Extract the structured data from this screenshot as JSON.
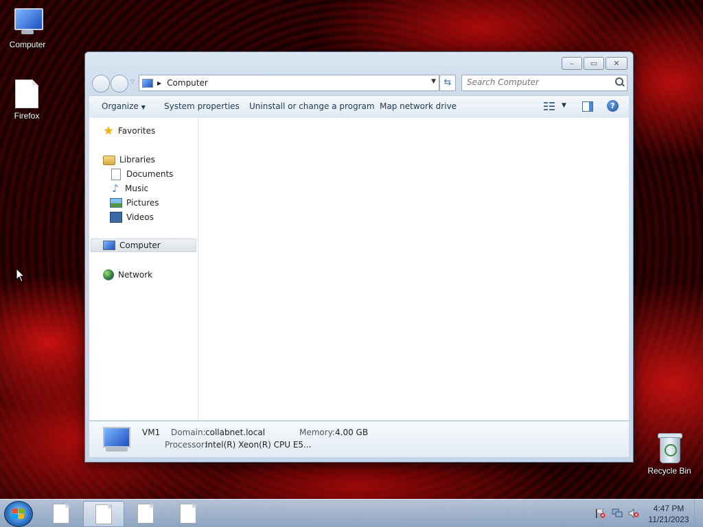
{
  "desktop": {
    "icons": [
      {
        "label": "Computer"
      },
      {
        "label": "Firefox"
      },
      {
        "label": "Recycle Bin"
      }
    ]
  },
  "window": {
    "caption_buttons": {
      "minimize": "–",
      "maximize": "▭",
      "close": "✕"
    },
    "address": {
      "current": "Computer"
    },
    "search": {
      "placeholder": "Search Computer"
    },
    "commands": {
      "organize": "Organize",
      "system_properties": "System properties",
      "uninstall": "Uninstall or change a program",
      "map_drive": "Map network drive"
    },
    "help_glyph": "?",
    "nav_pane": {
      "favorites": "Favorites",
      "libraries": "Libraries",
      "documents": "Documents",
      "music": "Music",
      "pictures": "Pictures",
      "videos": "Videos",
      "computer": "Computer",
      "network": "Network"
    },
    "details": {
      "name": "VM1",
      "domain_label": "Domain:",
      "domain_value": "collabnet.local",
      "memory_label": "Memory:",
      "memory_value": "4.00 GB",
      "processor_label": "Processor:",
      "processor_value": "Intel(R) Xeon(R) CPU E5..."
    }
  },
  "taskbar": {
    "clock_time": "4:47 PM",
    "clock_date": "11/21/2023"
  },
  "colors": {
    "accent": "#1e3955",
    "selection": "#dde2e8"
  }
}
